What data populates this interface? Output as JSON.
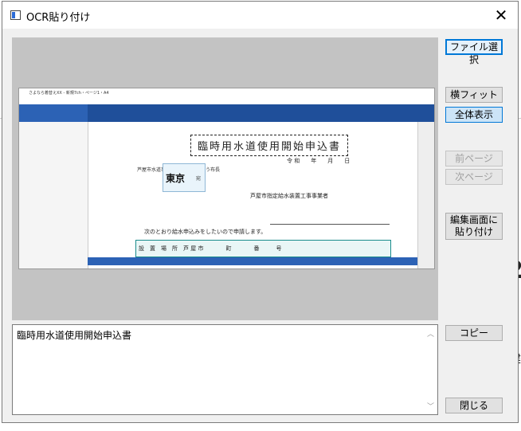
{
  "dialog": {
    "title": "OCR貼り付け",
    "close_glyph": "✕"
  },
  "buttons": {
    "file_select": "ファイル選択",
    "fit_width": "横フィット",
    "show_all": "全体表示",
    "prev_page": "前ページ",
    "next_page": "次ページ",
    "paste_editor_line1": "編集画面に",
    "paste_editor_line2": "貼り付け",
    "copy": "コピー",
    "close": "閉じる"
  },
  "ocr_result": {
    "text": "臨時用水道使用開始申込書"
  },
  "preview_image": {
    "window_title": "さよなら着替えXX - 新規7ch・ページ1・A4",
    "doc_title": "臨時用水道使用開始申込書",
    "date_line": "令 和　　年　　月　　日",
    "addressee_prefix": "芦屋市水道事",
    "addressee_suffix": "う布長",
    "stamp_text": "東京",
    "stamp_honorific": "宛",
    "contractor": "芦屋市指定給水装置工事事業者",
    "request_line": "次のとおり給水申込みをしたいので申請します。",
    "table_row": "設　置　場　所　芦 屋 市　　　　町　　　　番　　　号",
    "status_tabs": "新規7ch"
  }
}
